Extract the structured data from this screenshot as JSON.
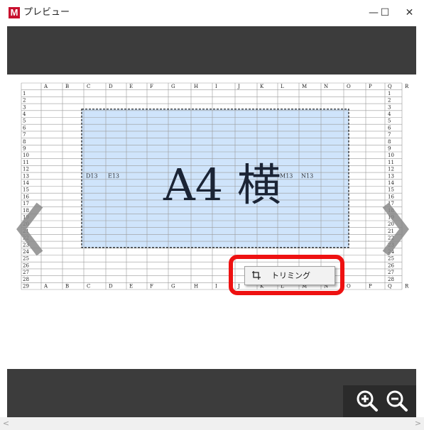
{
  "window": {
    "app_icon_letter": "M",
    "title": "プレビュー",
    "minimize_glyph": "—",
    "maximize_glyph": "☐",
    "close_glyph": "✕"
  },
  "sheet": {
    "column_headers": [
      "A",
      "B",
      "C",
      "D",
      "E",
      "F",
      "G",
      "H",
      "I",
      "J",
      "K",
      "L",
      "M",
      "N",
      "O",
      "P",
      "Q",
      "R"
    ],
    "row_numbers": [
      "1",
      "2",
      "3",
      "4",
      "5",
      "6",
      "7",
      "8",
      "9",
      "10",
      "11",
      "12",
      "13",
      "14",
      "15",
      "16",
      "17",
      "18",
      "19",
      "20",
      "21",
      "22",
      "23",
      "24",
      "25",
      "26",
      "27",
      "28"
    ],
    "last_row": {
      "number": "29",
      "cells": [
        "A",
        "B",
        "C",
        "D",
        "E",
        "F",
        "G",
        "H",
        "I",
        "J",
        "K",
        "L",
        "M",
        "N",
        "O",
        "P",
        "Q",
        "R"
      ]
    },
    "cell_labels": [
      "D13",
      "E13",
      "M13",
      "N13"
    ],
    "selection_text": "A4 横",
    "selection_fill": "#cfe4fb"
  },
  "navigation": {
    "prev_icon": "chevron-left-icon",
    "next_icon": "chevron-right-icon"
  },
  "zoom": {
    "zoom_in_icon": "zoom-in-icon",
    "zoom_out_icon": "zoom-out-icon"
  },
  "context_menu": {
    "items": [
      {
        "label": "トリミング",
        "icon": "crop-icon"
      }
    ]
  },
  "scrollbar": {
    "left_arrow": "<",
    "right_arrow": ">"
  },
  "colors": {
    "highlight": "#ee1111",
    "app_icon": "#c8102e",
    "background": "#3c3c3c"
  }
}
